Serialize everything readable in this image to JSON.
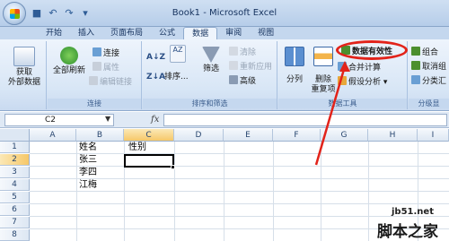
{
  "window": {
    "title": "Book1 - Microsoft Excel"
  },
  "quick_access": {
    "icons": [
      "save-icon",
      "undo-icon",
      "redo-icon",
      "customize-icon"
    ]
  },
  "tabs": [
    {
      "label": "开始"
    },
    {
      "label": "插入"
    },
    {
      "label": "页面布局"
    },
    {
      "label": "公式"
    },
    {
      "label": "数据",
      "active": true
    },
    {
      "label": "审阅"
    },
    {
      "label": "视图"
    }
  ],
  "ribbon": {
    "get_external": {
      "label": "获取\n外部数据",
      "line1": "获取",
      "line2": "外部数据"
    },
    "connections": {
      "refresh_all": "全部刷新",
      "connect": "连接",
      "properties": "属性",
      "edit_links": "编辑链接",
      "group_label": "连接"
    },
    "sort_filter": {
      "sort": "排序...",
      "filter": "筛选",
      "clear": "清除",
      "reapply": "重新应用",
      "advanced": "高级",
      "group_label": "排序和筛选"
    },
    "data_tools": {
      "text_to_columns": "分列",
      "remove_dup_line1": "删除",
      "remove_dup_line2": "重复项",
      "validation": "数据有效性",
      "consolidate": "合并计算",
      "whatif": "假设分析",
      "group_label": "数据工具"
    },
    "outline": {
      "group": "组合",
      "ungroup": "取消组",
      "subtotal": "分类汇",
      "group_label": "分级显"
    }
  },
  "formula_bar": {
    "name_box": "C2",
    "fx": "fx",
    "value": ""
  },
  "sheet": {
    "columns": [
      "A",
      "B",
      "C",
      "D",
      "E",
      "F",
      "G",
      "H",
      "I"
    ],
    "rows": [
      "1",
      "2",
      "3",
      "4",
      "5",
      "6",
      "7",
      "8"
    ],
    "selected_column": "C",
    "selected_row": "2",
    "cells": {
      "B1": "姓名",
      "C1": "性别",
      "B2": "张三",
      "B3": "李四",
      "B4": "江梅"
    }
  },
  "watermark": {
    "line1": "jb51.net",
    "line2": "脚本之家"
  },
  "colors": {
    "highlight": "#e2231a",
    "ribbon_bg": "#dae7f6",
    "selected_header": "#f6c869"
  }
}
